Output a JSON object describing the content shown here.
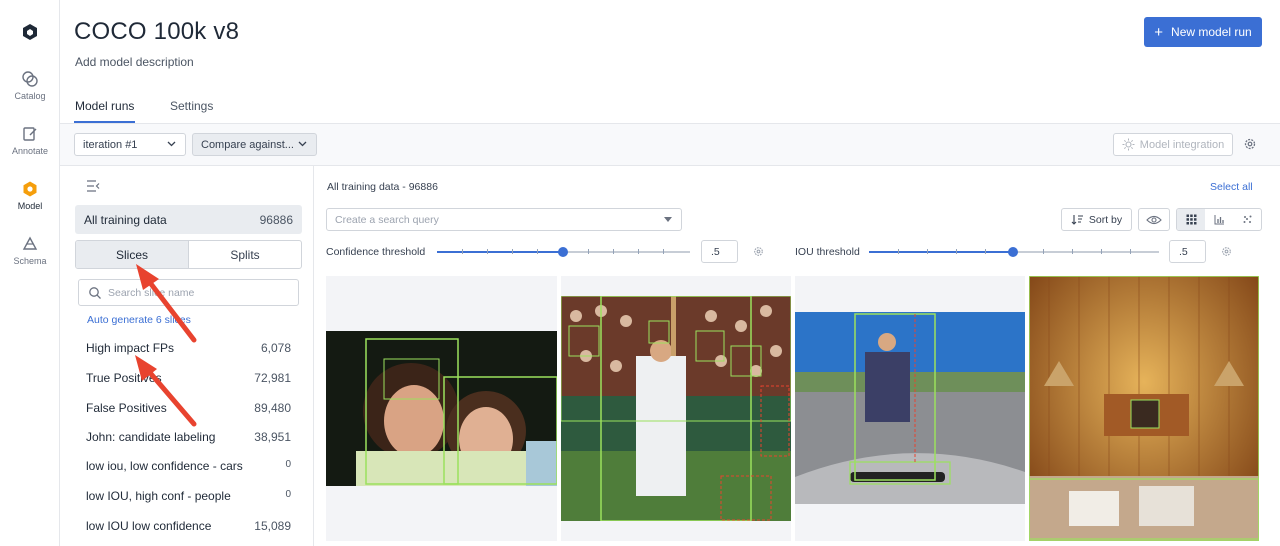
{
  "rail": {
    "items": [
      {
        "label": "Catalog"
      },
      {
        "label": "Annotate"
      },
      {
        "label": "Model"
      },
      {
        "label": "Schema"
      }
    ]
  },
  "header": {
    "title": "COCO 100k v8",
    "description": "Add model description",
    "new_run_label": "New model run"
  },
  "tabs": [
    {
      "label": "Model runs"
    },
    {
      "label": "Settings"
    }
  ],
  "toolbar": {
    "iteration": "iteration #1",
    "compare": "Compare against...",
    "model_integration": "Model integration"
  },
  "sidebar": {
    "all_data_label": "All training data",
    "all_data_count": "96886",
    "seg_slices": "Slices",
    "seg_splits": "Splits",
    "search_placeholder": "Search slice name",
    "auto_generate": "Auto generate 6 slices",
    "slices": [
      {
        "name": "High impact FPs",
        "count": "6,078"
      },
      {
        "name": "True Positives",
        "count": "72,981"
      },
      {
        "name": "False Positives",
        "count": "89,480"
      },
      {
        "name": "John: candidate labeling",
        "count": "38,951"
      },
      {
        "name": "low iou, low confidence - cars",
        "count": "0"
      },
      {
        "name": "low IOU, high conf - people",
        "count": "0"
      },
      {
        "name": "low IOU low confidence",
        "count": "15,089"
      }
    ]
  },
  "main": {
    "heading": "All training data - 96886",
    "select_all": "Select all",
    "query_placeholder": "Create a search query",
    "sort_label": "Sort by",
    "confidence_label": "Confidence threshold",
    "confidence_value": ".5",
    "iou_label": "IOU threshold",
    "iou_value": ".5"
  },
  "colors": {
    "accent": "#3b6fd4",
    "model_icon": "#f59e0b",
    "annotation_box": "#9be15d",
    "arrow": "#e8432f"
  }
}
